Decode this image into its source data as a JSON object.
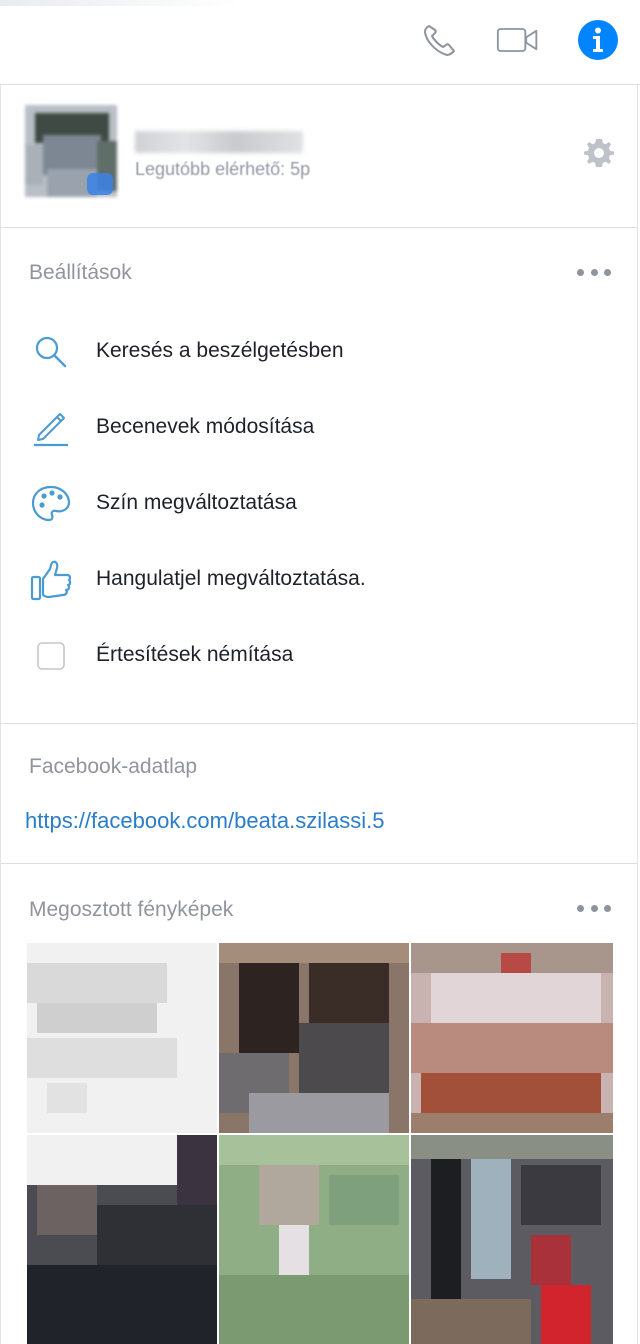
{
  "topbar": {
    "icons": [
      "phone-icon",
      "video-camera-icon",
      "info-icon"
    ]
  },
  "profile": {
    "status": "Legutóbb elérhető: 5p"
  },
  "settings": {
    "title": "Beállítások",
    "items": [
      {
        "icon": "search-icon",
        "label": "Keresés a beszélgetésben"
      },
      {
        "icon": "pencil-icon",
        "label": "Becenevek módosítása"
      },
      {
        "icon": "palette-icon",
        "label": "Szín megváltoztatása"
      },
      {
        "icon": "thumbs-up-icon",
        "label": "Hangulatjel megváltoztatása."
      },
      {
        "icon": "checkbox-icon",
        "label": "Értesítések némítása",
        "checked": false
      }
    ]
  },
  "facebook_profile": {
    "title": "Facebook-adatlap",
    "url": "https://facebook.com/beata.szilassi.5"
  },
  "shared_photos": {
    "title": "Megosztott fényképek"
  },
  "colors": {
    "accent": "#0084ff",
    "link": "#2b7dc9",
    "icon_blue": "#4a9ad4"
  }
}
